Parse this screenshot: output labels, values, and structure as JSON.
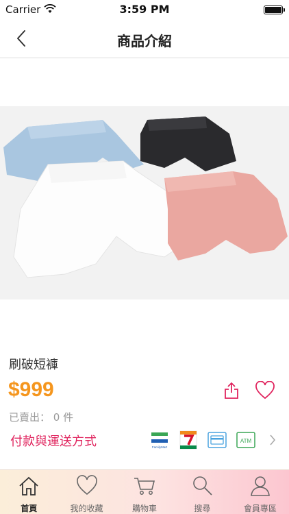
{
  "status": {
    "carrier": "Carrier",
    "time": "3:59 PM"
  },
  "nav": {
    "title": "商品介紹"
  },
  "product": {
    "name": "刷破短褲",
    "price": "$999",
    "sold": "已賣出： 0 件",
    "payment_link": "付款與運送方式"
  },
  "payment_icons": [
    {
      "name": "familymart-icon",
      "label": "FamilyMart"
    },
    {
      "name": "seven-eleven-icon",
      "label": "7-ELEVEn"
    },
    {
      "name": "credit-card-icon",
      "label": ""
    },
    {
      "name": "atm-icon",
      "label": "ATM"
    }
  ],
  "tabs": [
    {
      "label": "首頁",
      "icon": "home-icon",
      "active": true
    },
    {
      "label": "我的收藏",
      "icon": "heart-icon",
      "active": false
    },
    {
      "label": "購物車",
      "icon": "cart-icon",
      "active": false
    },
    {
      "label": "搜尋",
      "icon": "search-icon",
      "active": false
    },
    {
      "label": "會員專區",
      "icon": "user-icon",
      "active": false
    }
  ],
  "colors": {
    "price": "#f5961e",
    "accent": "#e0245e",
    "tab_bg_start": "#fbeed9",
    "tab_bg_end": "#fcc6d0"
  }
}
